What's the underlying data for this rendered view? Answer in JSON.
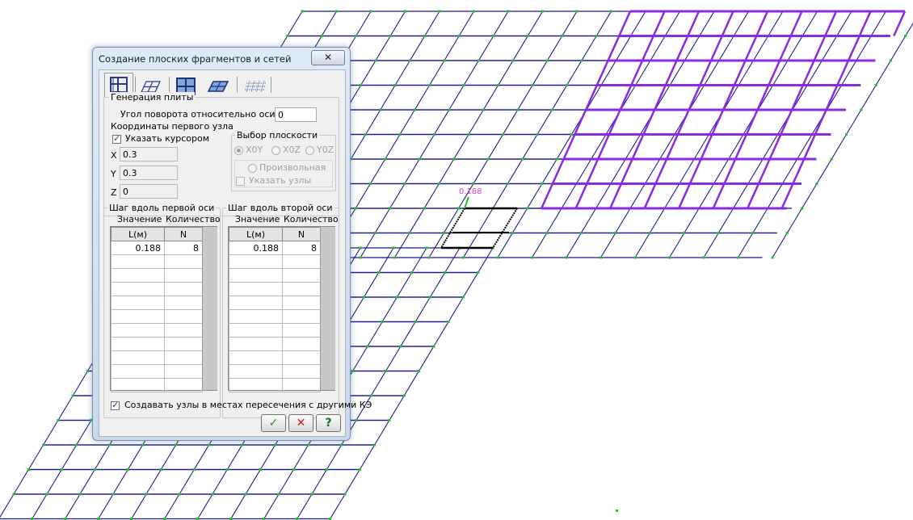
{
  "dialog": {
    "title": "Создание плоских фрагментов и сетей",
    "close_glyph": "✕",
    "tabs": [
      {
        "icon": "grid-frame-icon"
      },
      {
        "icon": "plate-skew-icon"
      },
      {
        "icon": "plate-grid-icon"
      },
      {
        "icon": "plate-skew-filled-icon"
      },
      {
        "icon": "hatched-grid-icon"
      }
    ],
    "plate_group": {
      "title": "Генерация плиты",
      "rotation_label": "Угол поворота относительно оси Z",
      "rotation_value": "0",
      "first_node_label": "Координаты первого узла",
      "cursor_checkbox_label": "Указать курсором",
      "cursor_checked": true,
      "x_label": "X",
      "x_value": "0.3",
      "y_label": "Y",
      "y_value": "0.3",
      "z_label": "Z",
      "z_value": "0"
    },
    "plane_group": {
      "title": "Выбор плоскости",
      "options": [
        "X0Y",
        "X0Z",
        "Y0Z"
      ],
      "selected": "X0Y",
      "arbitrary_label": "Произвольная",
      "nodes_checkbox_label": "Указать узлы"
    },
    "axis1": {
      "title": "Шаг вдоль первой оси",
      "value_header": "Значение",
      "count_header": "Количество",
      "col_l": "L(м)",
      "col_n": "N",
      "rows": [
        {
          "l": "0.188",
          "n": "8"
        }
      ]
    },
    "axis2": {
      "title": "Шаг вдоль второй оси",
      "value_header": "Значение",
      "count_header": "Количество",
      "col_l": "L(м)",
      "col_n": "N",
      "rows": [
        {
          "l": "0.188",
          "n": "8"
        }
      ]
    },
    "create_nodes_label": "Создавать узлы в местах пересечения с другими КЭ",
    "create_nodes_checked": true,
    "buttons": {
      "ok": "✓",
      "cancel": "✕",
      "help": "?"
    }
  },
  "canvas": {
    "dimension_label": "0.188",
    "colors": {
      "mesh": "#1a1a8c",
      "node": "#22c422",
      "selection": "#8a2be2",
      "dimension": "#d040d0"
    }
  }
}
